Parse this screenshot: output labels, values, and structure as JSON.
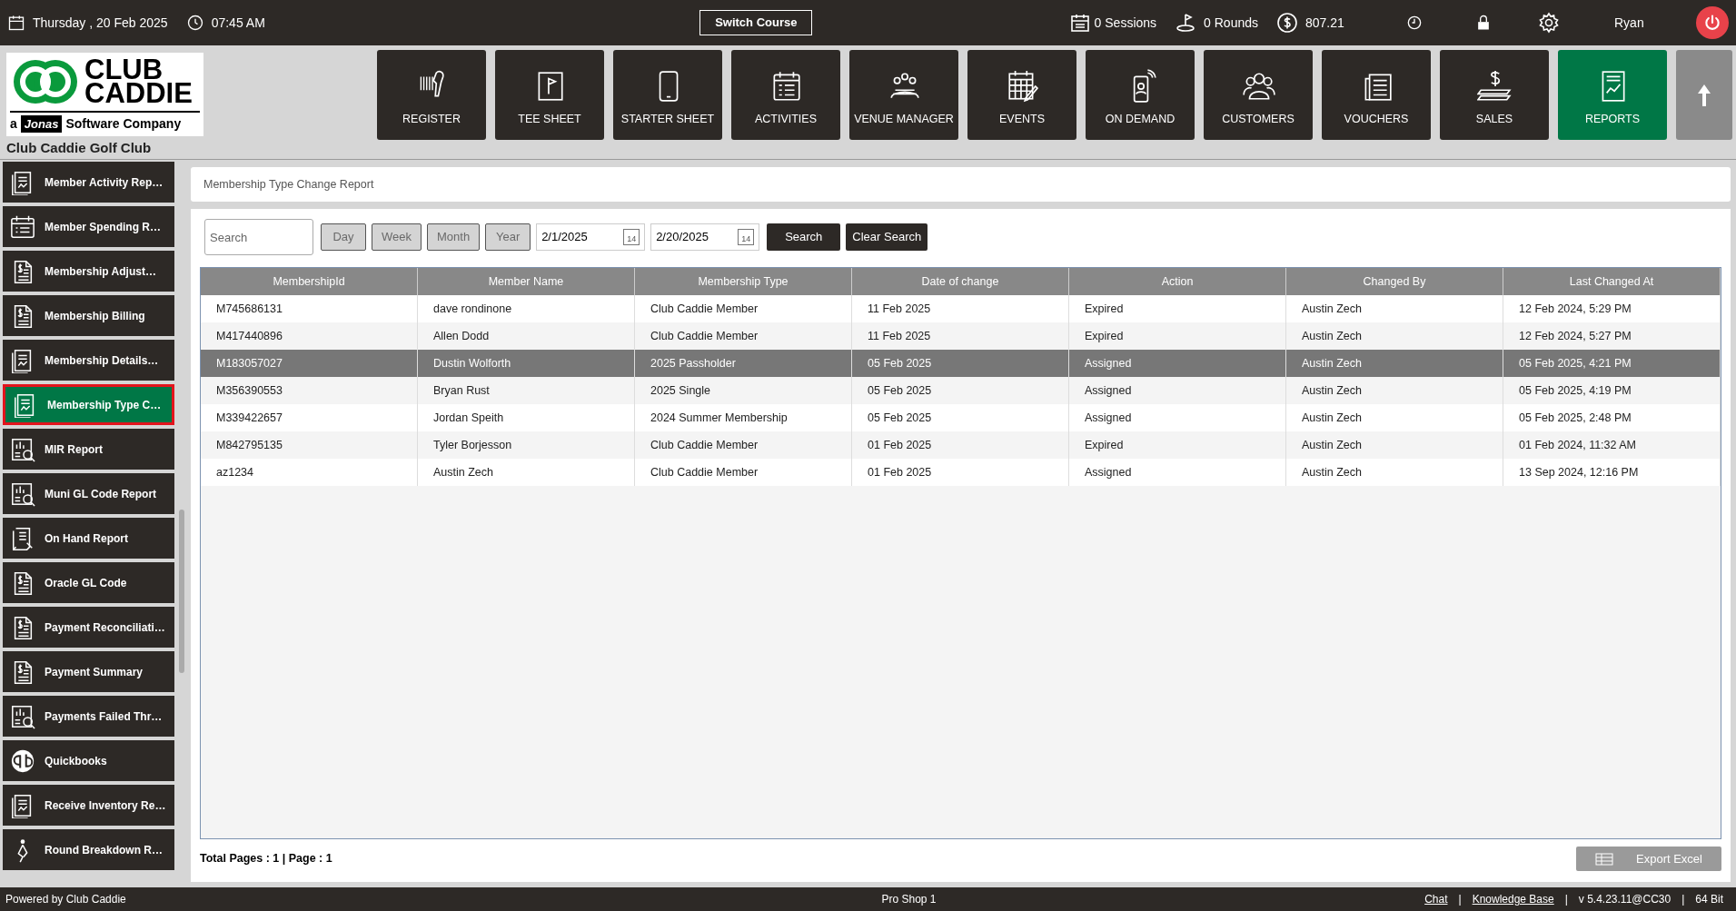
{
  "top_bar": {
    "date": "Thursday , 20 Feb 2025",
    "time": "07:45 AM",
    "switch_course": "Switch Course",
    "sessions": "0 Sessions",
    "rounds": "0 Rounds",
    "balance": "807.21",
    "user": "Ryan"
  },
  "logo": {
    "line_1": "CLUB",
    "line_2": "CADDIE",
    "prefix": "a",
    "brand": "Jonas",
    "suffix": "Software Company"
  },
  "club_name": "Club Caddie Golf Club",
  "nav": [
    {
      "label": "REGISTER",
      "selected": false
    },
    {
      "label": "TEE SHEET",
      "selected": false
    },
    {
      "label": "STARTER SHEET",
      "selected": false
    },
    {
      "label": "ACTIVITIES",
      "selected": false
    },
    {
      "label": "VENUE MANAGER",
      "selected": false
    },
    {
      "label": "EVENTS",
      "selected": false
    },
    {
      "label": "ON DEMAND",
      "selected": false
    },
    {
      "label": "CUSTOMERS",
      "selected": false
    },
    {
      "label": "VOUCHERS",
      "selected": false
    },
    {
      "label": "SALES",
      "selected": false
    },
    {
      "label": "REPORTS",
      "selected": true
    }
  ],
  "sidebar": {
    "items": [
      {
        "label": "Member Activity Rep…",
        "kind": "chart",
        "selected": false
      },
      {
        "label": "Member Spending R…",
        "kind": "calendar",
        "selected": false
      },
      {
        "label": "Membership Adjust…",
        "kind": "dollar",
        "selected": false
      },
      {
        "label": "Membership Billing",
        "kind": "dollar",
        "selected": false
      },
      {
        "label": "Membership Details…",
        "kind": "chart",
        "selected": false
      },
      {
        "label": "Membership Type C…",
        "kind": "chart",
        "selected": true
      },
      {
        "label": "MIR Report",
        "kind": "percent",
        "selected": false
      },
      {
        "label": "Muni GL Code Report",
        "kind": "percent",
        "selected": false
      },
      {
        "label": "On Hand Report",
        "kind": "receipt",
        "selected": false
      },
      {
        "label": "Oracle GL Code",
        "kind": "dollar",
        "selected": false
      },
      {
        "label": "Payment Reconciliati…",
        "kind": "dollar",
        "selected": false
      },
      {
        "label": "Payment Summary",
        "kind": "dollar",
        "selected": false
      },
      {
        "label": "Payments Failed Thr…",
        "kind": "percent",
        "selected": false
      },
      {
        "label": "Quickbooks",
        "kind": "qb",
        "selected": false
      },
      {
        "label": "Receive Inventory Re…",
        "kind": "chart",
        "selected": false
      },
      {
        "label": "Round Breakdown R…",
        "kind": "walker",
        "selected": false
      }
    ]
  },
  "report": {
    "title": "Membership Type Change Report",
    "filters": {
      "search": {
        "placeholder": "Search"
      },
      "periods": [
        {
          "label": "Day",
          "disabled": true
        },
        {
          "label": "Week",
          "disabled": true
        },
        {
          "label": "Month",
          "disabled": true
        },
        {
          "label": "Year",
          "disabled": true
        }
      ],
      "from_date": "2/1/2025",
      "to_date": "2/20/2025",
      "from_calendar_day": "14",
      "to_calendar_day": "14",
      "search_button": "Search",
      "clear_button": "Clear Search"
    },
    "table": {
      "columns": [
        "MembershipId",
        "Member Name",
        "Membership Type",
        "Date of change",
        "Action",
        "Changed By",
        "Last Changed At"
      ],
      "rows": [
        {
          "cells": [
            "M745686131",
            "dave rondinone",
            "Club Caddie Member",
            "11 Feb 2025",
            "Expired",
            "Austin Zech",
            "12 Feb 2024, 5:29 PM"
          ],
          "selected": false
        },
        {
          "cells": [
            "M417440896",
            "Allen Dodd",
            "Club Caddie Member",
            "11 Feb 2025",
            "Expired",
            "Austin Zech",
            "12 Feb 2024, 5:27 PM"
          ],
          "selected": false
        },
        {
          "cells": [
            "M183057027",
            "Dustin Wolforth",
            "2025 Passholder",
            "05 Feb 2025",
            "Assigned",
            "Austin Zech",
            "05 Feb 2025, 4:21 PM"
          ],
          "selected": true
        },
        {
          "cells": [
            "M356390553",
            "Bryan Rust",
            "2025 Single",
            "05 Feb 2025",
            "Assigned",
            "Austin Zech",
            "05 Feb 2025, 4:19 PM"
          ],
          "selected": false
        },
        {
          "cells": [
            "M339422657",
            "Jordan Speith",
            "2024 Summer Membership",
            "05 Feb 2025",
            "Assigned",
            "Austin Zech",
            "05 Feb 2025, 2:48 PM"
          ],
          "selected": false
        },
        {
          "cells": [
            "M842795135",
            "Tyler Borjesson",
            "Club Caddie Member",
            "01 Feb 2025",
            "Expired",
            "Austin Zech",
            "01 Feb 2024, 11:32 AM"
          ],
          "selected": false
        },
        {
          "cells": [
            "az1234",
            "Austin Zech",
            "Club Caddie Member",
            "01 Feb 2025",
            "Assigned",
            "Austin Zech",
            "13 Sep 2024, 12:16 PM"
          ],
          "selected": false
        }
      ]
    },
    "pages": "Total Pages : 1 | Page : 1",
    "export_button": "Export Excel"
  },
  "status_bar": {
    "powered": "Powered by Club Caddie",
    "station": "Pro Shop 1",
    "links": [
      "Chat",
      "Knowledge Base"
    ],
    "separators": [
      "|",
      "|",
      "|"
    ],
    "version": "v 5.4.23.11@CC30",
    "bits": "64 Bit"
  }
}
